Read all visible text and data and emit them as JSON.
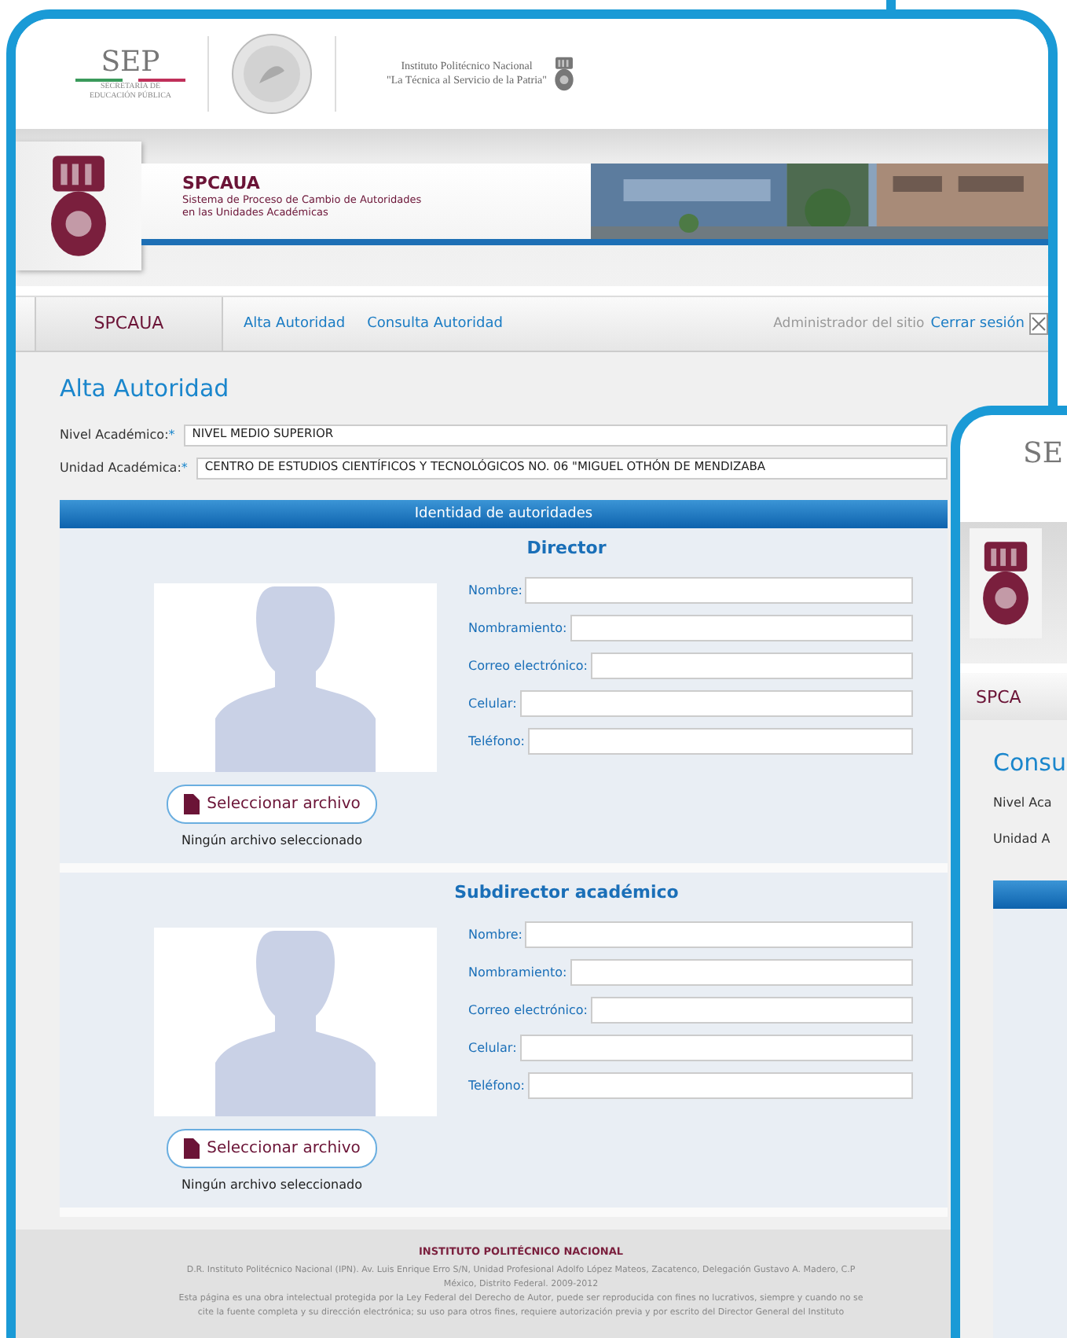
{
  "main_window": {
    "header": {
      "agency": "SEP",
      "agency_subtitle": [
        "SECRETARÍA DE",
        "EDUCACIÓN PÚBLICA"
      ],
      "institute_lines": [
        "Instituto Politécnico Nacional",
        "\"La Técnica al Servicio de la Patria\""
      ]
    },
    "banner": {
      "title": "SPCAUA",
      "subtitle_lines": [
        "Sistema de Proceso de Cambio de Autoridades",
        "en las Unidades Académicas"
      ]
    },
    "nav": {
      "tabs": [
        {
          "label": "SPCAUA",
          "selected": true
        },
        {
          "label": "Alta Autoridad",
          "selected": false
        },
        {
          "label": "Consulta Autoridad",
          "selected": false
        }
      ],
      "user": "Administrador del sitio",
      "logout": "Cerrar sesión"
    },
    "page_title": "Alta Autoridad",
    "fields": [
      {
        "label": "Nivel Académico:",
        "required_mark": "*",
        "value": "NIVEL MEDIO SUPERIOR"
      },
      {
        "label": "Unidad Académica:",
        "required_mark": "*",
        "value": "CENTRO DE ESTUDIOS CIENTÍFICOS Y TECNOLÓGICOS NO. 06 \"MIGUEL OTHÓN DE MENDIZABA"
      }
    ],
    "section_title": "Identidad de autoridades",
    "authorities": [
      {
        "role": "Director",
        "fields": [
          "Nombre:",
          "Nombramiento:",
          "Correo electrónico:",
          "Celular:",
          "Teléfono:"
        ],
        "file_button": "Seleccionar archivo",
        "file_status": "Ningún archivo seleccionado"
      },
      {
        "role": "Subdirector académico",
        "fields": [
          "Nombre:",
          "Nombramiento:",
          "Correo electrónico:",
          "Celular:",
          "Teléfono:"
        ],
        "file_button": "Seleccionar archivo",
        "file_status": "Ningún archivo seleccionado"
      }
    ],
    "footer": {
      "title": "INSTITUTO POLITÉCNICO NACIONAL",
      "lines": [
        "D.R. Instituto Politécnico Nacional (IPN). Av. Luis Enrique Erro S/N, Unidad Profesional Adolfo López Mateos, Zacatenco, Delegación Gustavo A. Madero, C.P",
        "México, Distrito Federal. 2009-2012",
        "Esta página es una obra intelectual protegida por la Ley Federal del Derecho de Autor, puede ser reproducida con fines no lucrativos, siempre y cuando no se",
        "cite la fuente completa y su dirección electrónica; su uso para otros fines, requiere autorización previa y por escrito del Director General del Instituto"
      ]
    }
  },
  "second_window": {
    "agency": "SE",
    "tab": "SPCA",
    "page_title": "Consu",
    "field_labels": [
      "Nivel Aca",
      "Unidad A"
    ]
  }
}
